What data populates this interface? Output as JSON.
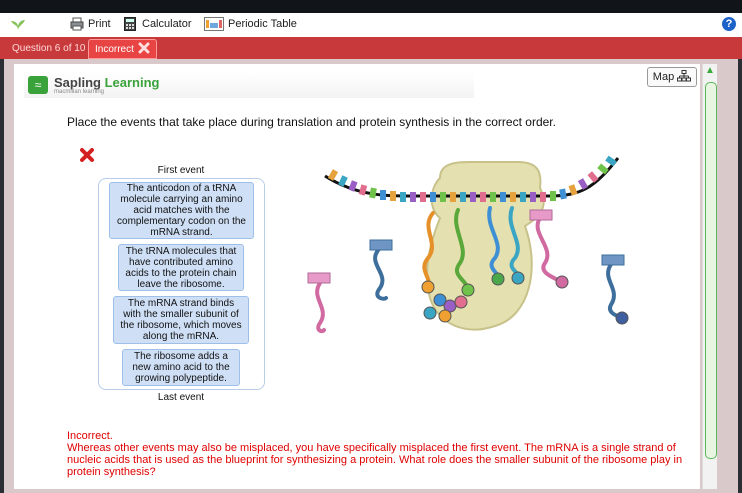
{
  "toolbar": {
    "print": "Print",
    "calculator": "Calculator",
    "periodic_table": "Periodic Table",
    "help": "?"
  },
  "tabs": {
    "question": "Question 6 of 10",
    "status": "Incorrect"
  },
  "brand": {
    "name_first": "Sapling ",
    "name_second": "Learning",
    "sub": "macmillan learning"
  },
  "map_button": "Map",
  "question": "Place the events that take place during translation and protein synthesis in the correct order.",
  "order": {
    "first_label": "First event",
    "last_label": "Last event",
    "events": [
      "The anticodon of a tRNA molecule carrying an amino acid matches with the complementary codon on the mRNA strand.",
      "The tRNA molecules that have contributed amino acids to the protein chain leave the ribosome.",
      "The mRNA strand binds with the smaller subunit of the ribosome, which moves along the mRNA.",
      "The ribosome adds a new amino acid to the growing polypeptide."
    ]
  },
  "feedback": {
    "title": "Incorrect.",
    "body": "Whereas other events may also be misplaced, you have specifically misplaced the first event. The mRNA is a single strand of nucleic acids that is used as the blueprint for synthesizing a protein. What role does the smaller subunit of the ribosome play in protein synthesis?"
  },
  "colors": {
    "accent_red": "#c8393b",
    "error_text": "#e00000",
    "card_blue": "#cfe0f6",
    "brand_green": "#3aa23a"
  }
}
